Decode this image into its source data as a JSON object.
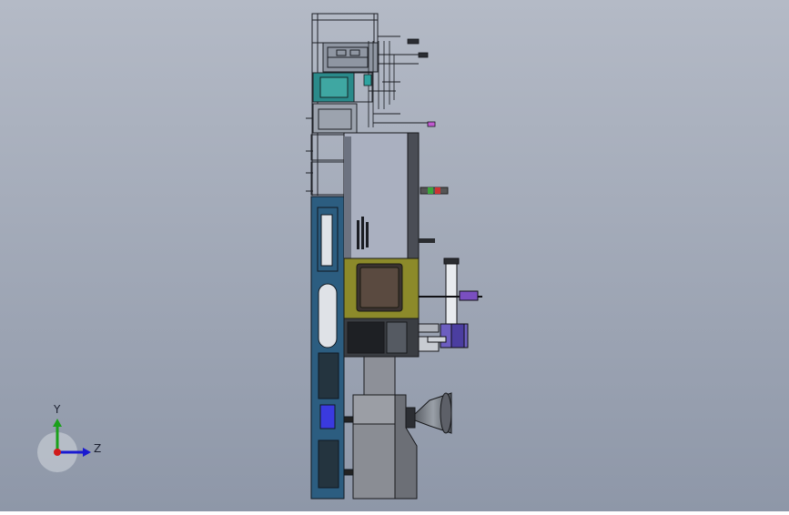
{
  "viewport": {
    "background_top": "#b4bac6",
    "background_bottom": "#8e97a8",
    "model": "injection-molding-machine-side-view"
  },
  "triad": {
    "y_label": "Y",
    "z_label": "Z",
    "y_color": "#1aa01a",
    "z_color": "#1a1ad0",
    "x_color": "#d01a1a"
  }
}
